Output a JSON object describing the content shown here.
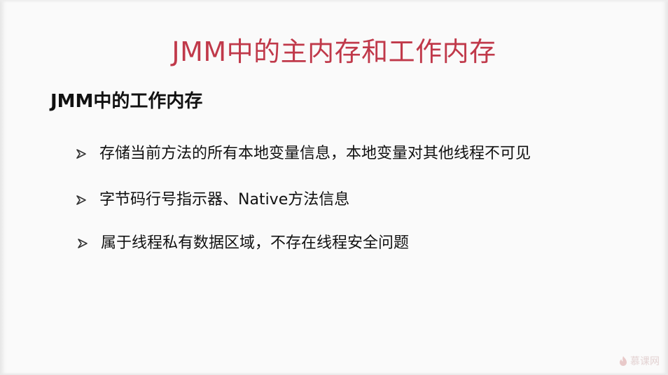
{
  "slide": {
    "title": "JMM中的主内存和工作内存",
    "subtitle": "JMM中的工作内存",
    "bullets": [
      "存储当前方法的所有本地变量信息，本地变量对其他线程不可见",
      "字节码行号指示器、Native方法信息",
      "属于线程私有数据区域，不存在线程安全问题"
    ],
    "bullet_icon": "arrow-bullet-icon"
  },
  "watermark": {
    "text": "慕课网",
    "icon": "flame-logo-icon"
  },
  "colors": {
    "title": "#c0394a",
    "text": "#111111",
    "background": "#fafafa",
    "watermark": "#e3d2d2"
  }
}
